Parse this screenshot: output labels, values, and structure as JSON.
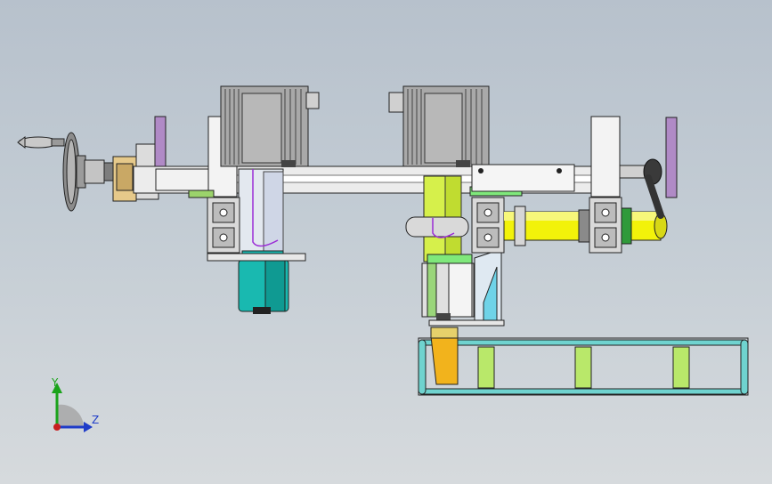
{
  "viewport": {
    "background_top": "#b7c1cc",
    "background_bottom": "#d6dadd"
  },
  "triad": {
    "y_label": "Y",
    "z_label": "Z",
    "y_color": "#1aa31a",
    "z_color": "#1f3cc8",
    "x_color": "#c81f1f",
    "icon": "coordinate-triad-icon"
  },
  "colors": {
    "motor_body": "#a9a9a9",
    "cyan_cylinder": "#19b9b0",
    "yellow_green": "#d6f04b",
    "yellow": "#f2f20a",
    "purple_plate": "#b08ac6",
    "tan_block": "#e6c98a",
    "teal_frame": "#6fd3cf",
    "lime": "#b9e86a",
    "orange": "#f2b31c",
    "outline": "#1a1a1a"
  }
}
